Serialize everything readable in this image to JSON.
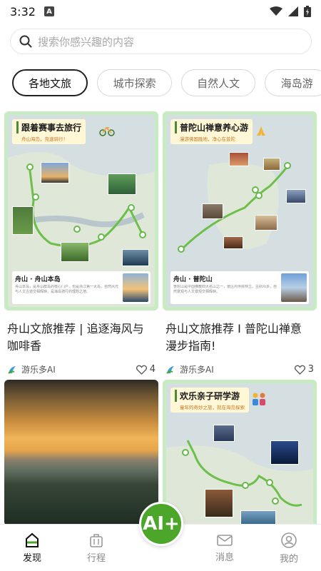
{
  "status_bar": {
    "time": "3:32",
    "notif_letter": "A"
  },
  "search": {
    "placeholder": "搜索你感兴趣的内容"
  },
  "tabs": [
    {
      "label": "各地文旅",
      "active": true
    },
    {
      "label": "城市探索",
      "active": false
    },
    {
      "label": "自然人文",
      "active": false
    },
    {
      "label": "海岛游",
      "active": false
    }
  ],
  "cards": [
    {
      "map_title": "跟着赛事去旅行",
      "map_subtitle": "舟山海岛，竞速骑行！",
      "info_title": "舟山 · 舟山本岛",
      "info_text": "舟山本岛，是舟山群岛的核心门户，也是浙江第一大岛，自然风光与人文古迹交相辉映，是海岛骑行的理想之地。",
      "title": "舟山文旅推荐 | 追逐海风与咖啡香",
      "author": "游乐多AI",
      "likes": "4"
    },
    {
      "map_title": "普陀山禅意养心游",
      "map_subtitle": "漫游佛国胜地，净心在普陀",
      "info_title": "舟山 · 普陀山",
      "info_text": "普陀山是中国佛教四大名山之一，景区内寺院林立、古刹众多，自然景观与人文景观交相辉映。",
      "title": "舟山文旅推荐 I 普陀山禅意漫步指南!",
      "author": "游乐多AI",
      "likes": "3"
    },
    {
      "map_title": "欢乐亲子研学游",
      "map_subtitle": "童年的奇妙之旅，就在海岛探索"
    }
  ],
  "fab": {
    "label": "AI+"
  },
  "nav": [
    {
      "label": "发现",
      "icon": "discover-icon",
      "active": true
    },
    {
      "label": "行程",
      "icon": "luggage-icon",
      "active": false
    },
    {
      "label": "",
      "icon": "",
      "active": false
    },
    {
      "label": "消息",
      "icon": "mail-icon",
      "active": false
    },
    {
      "label": "我的",
      "icon": "profile-icon",
      "active": false
    }
  ],
  "colors": {
    "accent_green": "#4ca62a",
    "map_frame": "#c7ebc2",
    "route": "#6cc04a"
  }
}
